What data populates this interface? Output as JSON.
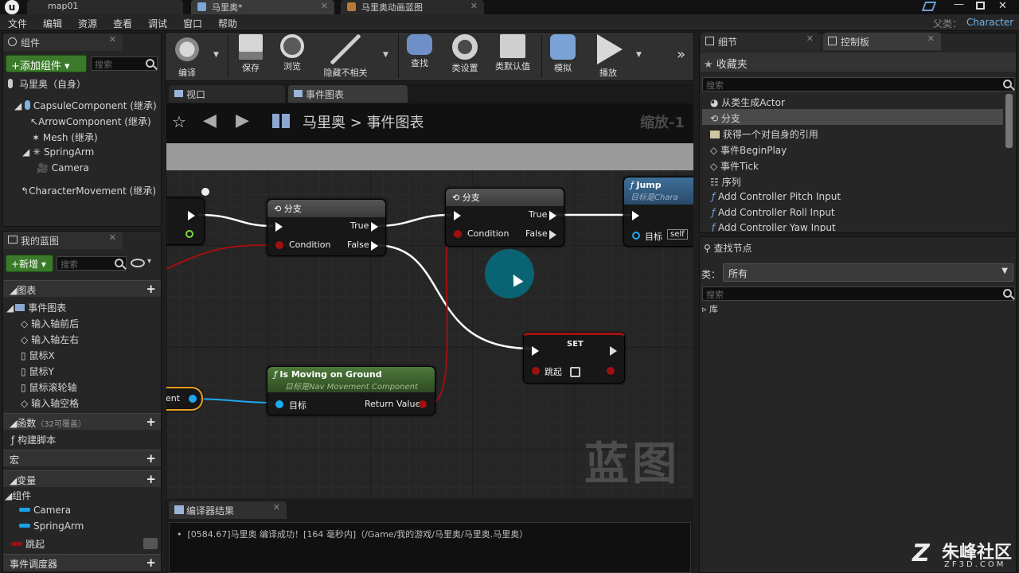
{
  "app_tabs": [
    {
      "label": "map01"
    },
    {
      "label": "马里奥*"
    },
    {
      "label": "马里奥动画蓝图"
    }
  ],
  "parent_label": "父类：",
  "parent_value": "Character",
  "menu": [
    "文件",
    "编辑",
    "资源",
    "查看",
    "调试",
    "窗口",
    "帮助"
  ],
  "components_panel": {
    "tab": "组件",
    "add_button": "+添加组件",
    "search_placeholder": "搜索",
    "self_item": "马里奥（自身）",
    "tree": [
      "CapsuleComponent (继承)",
      "ArrowComponent (继承)",
      "Mesh (继承)",
      "SpringArm",
      "Camera",
      "CharacterMovement (继承)"
    ]
  },
  "my_blueprint": {
    "tab": "我的蓝图",
    "new_button": "+新增",
    "search_placeholder": "搜索",
    "graphs_header": "图表",
    "event_graph": "事件图表",
    "events": [
      "输入轴前后",
      "输入轴左右",
      "鼠标X",
      "鼠标Y",
      "鼠标滚轮轴",
      "输入轴空格"
    ],
    "functions_header": "函数",
    "functions_note": "（32可覆盖）",
    "construction_script": "构建脚本",
    "macros_header": "宏",
    "variables_header": "变量",
    "components_header": "组件",
    "variables": [
      "Camera",
      "SpringArm"
    ],
    "jump_var": "跳起",
    "dispatchers_header": "事件调度器"
  },
  "toolbar": [
    {
      "label": "编译"
    },
    {
      "label": "保存"
    },
    {
      "label": "浏览"
    },
    {
      "label": "隐藏不相关"
    },
    {
      "label": "查找"
    },
    {
      "label": "类设置"
    },
    {
      "label": "类默认值"
    },
    {
      "label": "模拟"
    },
    {
      "label": "播放"
    }
  ],
  "editor_tabs": [
    "视口",
    "事件图表"
  ],
  "breadcrumb": {
    "root": "马里奥",
    "sep": ">",
    "current": "事件图表"
  },
  "zoom_label": "缩放-1",
  "graph_watermark": "蓝图",
  "nodes": {
    "branch1": {
      "title": "分支",
      "condition": "Condition",
      "true": "True",
      "false": "False"
    },
    "branch2": {
      "title": "分支",
      "condition": "Condition",
      "true": "True",
      "false": "False"
    },
    "jump": {
      "title": "Jump",
      "subtitle": "目标是Chara",
      "target": "目标",
      "self": "self"
    },
    "set": {
      "title": "SET",
      "var": "跳起"
    },
    "moving": {
      "title": "Is Moving on Ground",
      "subtitle": "目标是Nav Movement Component",
      "target": "目标",
      "return": "Return Value"
    },
    "cut_left": {
      "label": "nent"
    }
  },
  "compiler": {
    "tab": "编译器结果",
    "message": "[0584.67]马里奥 编译成功！[164 毫秒内]（/Game/我的游戏/马里奥/马里奥.马里奥）"
  },
  "details_tab": "细节",
  "palette": {
    "tab": "控制板",
    "favorites": "收藏夹",
    "search_placeholder": "搜索",
    "items": [
      "从类生成Actor",
      "分支",
      "获得一个对自身的引用",
      "事件BeginPlay",
      "事件Tick",
      "序列",
      "Add Controller Pitch Input",
      "Add Controller Roll Input",
      "Add Controller Yaw Input"
    ]
  },
  "find_nodes": {
    "title": "查找节点",
    "category_label": "类：",
    "category_value": "所有",
    "search_placeholder": "搜索",
    "library": "库"
  },
  "watermark": {
    "brand": "朱峰社区",
    "url": "ZF3D.COM"
  },
  "colors": {
    "exec": "#ffffff",
    "bool_pin": "#8b0000",
    "object_pin": "#00a8f3",
    "accent_green": "#3a7a2a"
  }
}
